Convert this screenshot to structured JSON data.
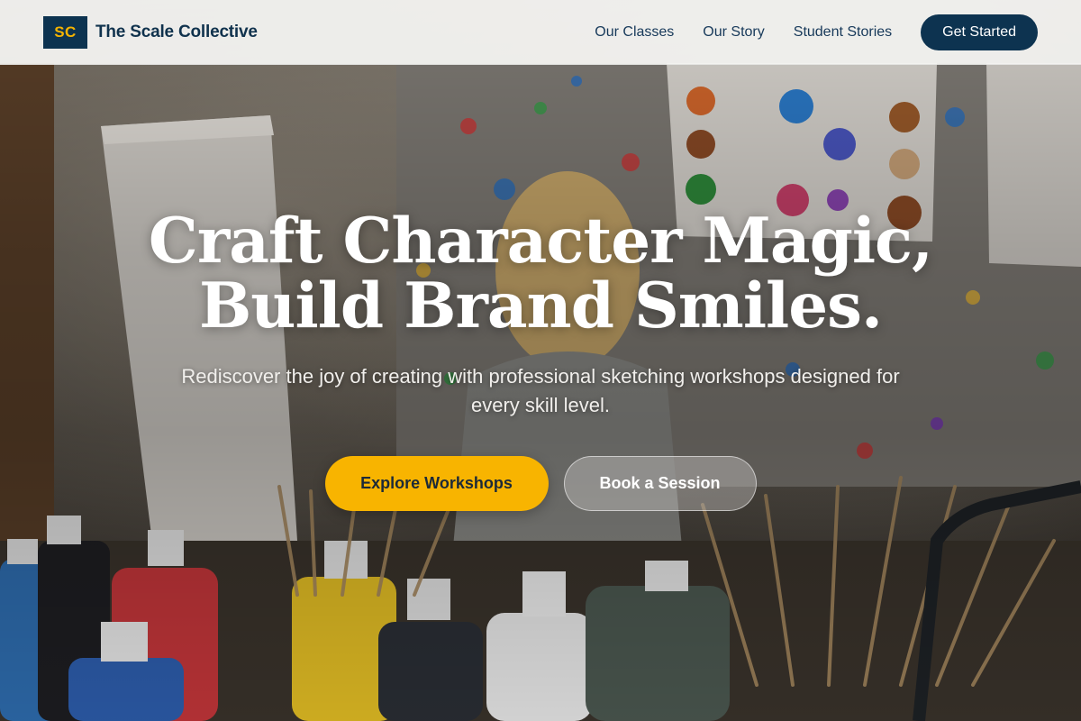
{
  "nav": {
    "logo_initials": "SC",
    "brand_name": "The Scale Collective",
    "links": [
      {
        "label": "Our Classes"
      },
      {
        "label": "Our Story"
      },
      {
        "label": "Student Stories"
      }
    ],
    "cta_label": "Get Started"
  },
  "hero": {
    "title_line1": "Craft Character Magic,",
    "title_line2": "Build Brand Smiles.",
    "subtitle": "Rediscover the joy of creating with professional sketching workshops designed for every skill level.",
    "primary_button": "Explore Workshops",
    "secondary_button": "Book a Session",
    "background_scene": "art-studio-paint-bottles-photo"
  },
  "colors": {
    "navy": "#0d3350",
    "accent_yellow": "#f8b400",
    "logo_yellow": "#f5b301",
    "nav_text": "#17395a"
  }
}
